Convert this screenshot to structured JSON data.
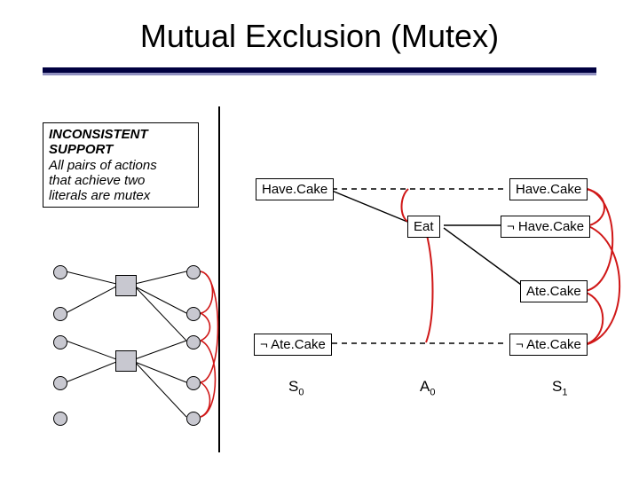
{
  "title": "Mutual Exclusion (Mutex)",
  "definition": {
    "heading_line1": "INCONSISTENT",
    "heading_line2": "SUPPORT",
    "body_line1": "All pairs of actions",
    "body_line2": "that achieve two",
    "body_line3": "literals are mutex"
  },
  "graph": {
    "s0": {
      "have_cake": "Have.Cake",
      "not_ate_cake": "¬ Ate.Cake",
      "label": "S",
      "sub": "0"
    },
    "a0": {
      "eat": "Eat",
      "label": "A",
      "sub": "0"
    },
    "s1": {
      "have_cake": "Have.Cake",
      "not_have_cake": "¬ Have.Cake",
      "ate_cake": "Ate.Cake",
      "not_ate_cake": "¬ Ate.Cake",
      "label": "S",
      "sub": "1"
    }
  },
  "colors": {
    "mutex": "#d01818"
  }
}
